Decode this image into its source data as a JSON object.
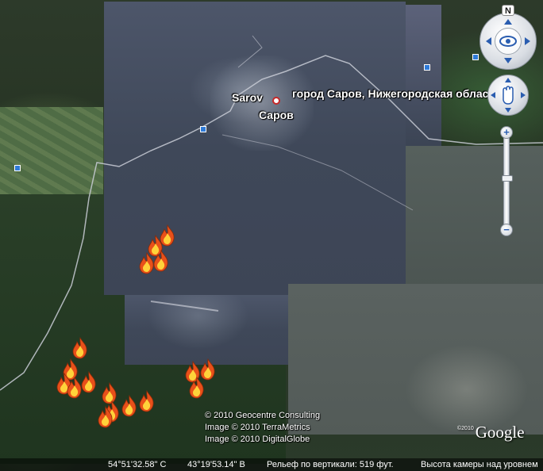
{
  "map": {
    "labels": {
      "sarov_latin": "Sarov",
      "sarov_cyrillic": "Саров",
      "region_label": "город Саров, Нижегородская область"
    },
    "fire_icon": "fire-icon",
    "poi_icon": "info-square-icon",
    "colors": {
      "fire_outer": "#e8501a",
      "fire_inner": "#ffd23a",
      "road": "#c9ccd6",
      "poi": "#2f7bd8"
    }
  },
  "copyright": {
    "line1": "© 2010 Geocentre Consulting",
    "line2": "Image © 2010 TerraMetrics",
    "line3": "Image © 2010 DigitalGlobe"
  },
  "logo": {
    "year": "©2010",
    "text": "Google"
  },
  "status": {
    "latitude": "54°51'32.58\" С",
    "longitude": "43°19'53.14\" В",
    "elevation": "Рельеф по вертикали:  519 фут.",
    "eye_alt": "Высота камеры над уровнем"
  },
  "controls": {
    "north_label": "N",
    "zoom_in_label": "+",
    "zoom_out_label": "−",
    "look_icon": "eye-icon",
    "move_icon": "hand-icon",
    "zoom_level": 0.45
  }
}
